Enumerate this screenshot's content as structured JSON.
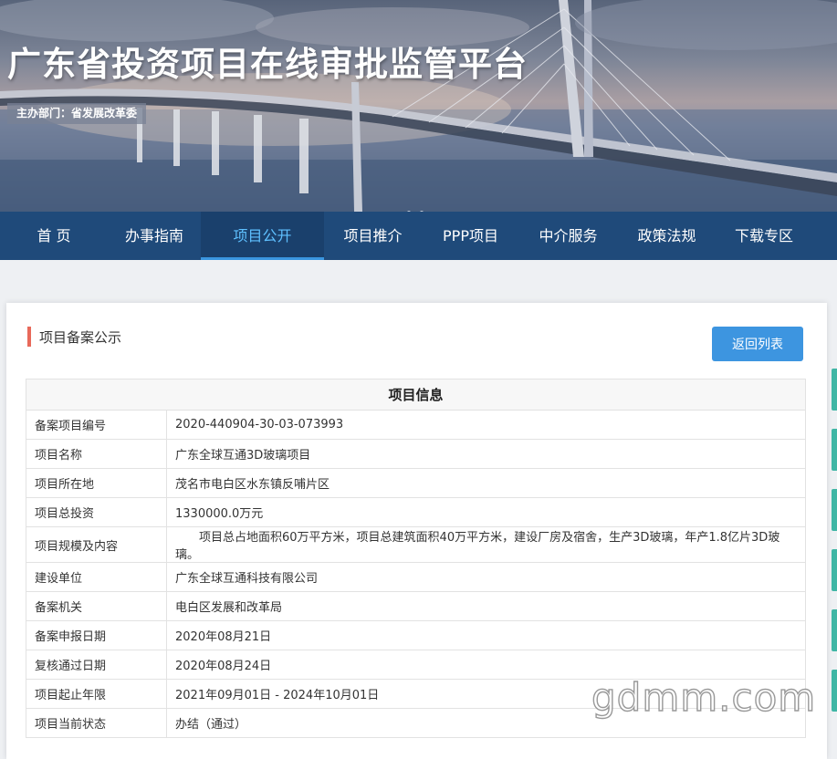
{
  "banner": {
    "site_title": "广东省投资项目在线审批监管平台",
    "host_dept": "主办部门：省发展改革委"
  },
  "nav": {
    "items": [
      {
        "label": "首 页",
        "active": false
      },
      {
        "label": "办事指南",
        "active": false
      },
      {
        "label": "项目公开",
        "active": true
      },
      {
        "label": "项目推介",
        "active": false
      },
      {
        "label": "PPP项目",
        "active": false
      },
      {
        "label": "中介服务",
        "active": false
      },
      {
        "label": "政策法规",
        "active": false
      },
      {
        "label": "下载专区",
        "active": false
      }
    ]
  },
  "section": {
    "title": "项目备案公示",
    "back_button": "返回列表"
  },
  "table": {
    "header": "项目信息",
    "rows": [
      {
        "label": "备案项目编号",
        "value": "2020-440904-30-03-073993"
      },
      {
        "label": "项目名称",
        "value": "广东全球互通3D玻璃项目"
      },
      {
        "label": "项目所在地",
        "value": "茂名市电白区水东镇反哺片区"
      },
      {
        "label": "项目总投资",
        "value": "1330000.0万元"
      },
      {
        "label": "项目规模及内容",
        "value": "项目总占地面积60万平方米，项目总建筑面积40万平方米，建设厂房及宿舍，生产3D玻璃，年产1.8亿片3D玻璃。"
      },
      {
        "label": "建设单位",
        "value": "广东全球互通科技有限公司"
      },
      {
        "label": "备案机关",
        "value": "电白区发展和改革局"
      },
      {
        "label": "备案申报日期",
        "value": "2020年08月21日"
      },
      {
        "label": "复核通过日期",
        "value": "2020年08月24日"
      },
      {
        "label": "项目起止年限",
        "value": "2021年09月01日 - 2024年10月01日"
      },
      {
        "label": "项目当前状态",
        "value": "办结（通过）"
      }
    ]
  },
  "watermark": "gdmm.com",
  "colors": {
    "nav_bg": "#1f4a7a",
    "nav_active_text": "#5fc0ff",
    "accent_bar": "#e8695a",
    "button": "#3d95e0"
  }
}
